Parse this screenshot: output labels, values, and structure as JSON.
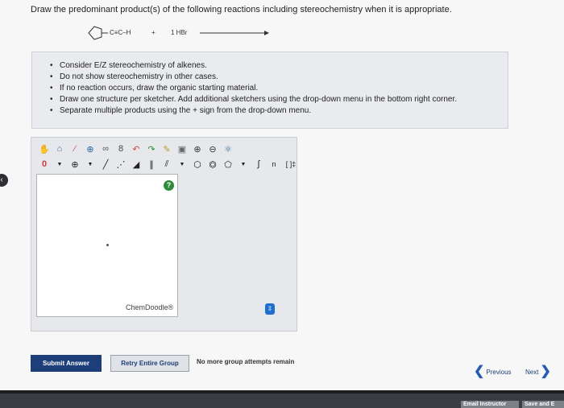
{
  "question": "Draw the predominant product(s) of the following reactions including stereochemistry when it is appropriate.",
  "reaction": {
    "reactant_label": "C≡C–H",
    "plus": "+",
    "reagent": "1 HBr"
  },
  "instructions": [
    "Consider E/Z stereochemistry of alkenes.",
    "Do not show stereochemistry in other cases.",
    "If no reaction occurs, draw the organic starting material.",
    "Draw one structure per sketcher. Add additional sketchers using the drop-down menu in the bottom right corner.",
    "Separate multiple products using the + sign from the drop-down menu."
  ],
  "sketcher": {
    "charge_value": "0",
    "help": "?",
    "brand": "ChemDoodle®",
    "bracket_label": "[ ]‡",
    "subscript_label": "n"
  },
  "buttons": {
    "submit": "Submit Answer",
    "retry": "Retry Entire Group",
    "attempts": "No more group attempts remain",
    "previous": "Previous",
    "next": "Next"
  },
  "footer": {
    "email": "Email Instructor",
    "save": "Save and E"
  },
  "colors": {
    "primary": "#1d3e78",
    "help_green": "#2e8b3c",
    "expand_blue": "#1f6fd1"
  }
}
